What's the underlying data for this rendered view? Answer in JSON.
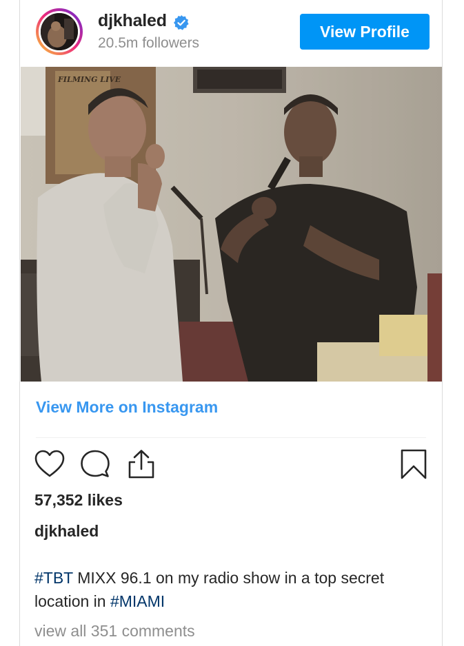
{
  "header": {
    "username": "djkhaled",
    "followers": "20.5m followers",
    "view_profile_label": "View Profile",
    "verified_icon": "verified-badge-icon",
    "accent_color": "#0095f6"
  },
  "post": {
    "image_icon": "photo",
    "image_text": "FILMING LIVE",
    "view_more_label": "View More on Instagram",
    "likes": "57,352 likes",
    "caption_user": "djkhaled",
    "caption": {
      "tag1": "#TBT",
      "text1": " MIXX 96.1 on my radio show in a top secret location in ",
      "tag2": "#MIAMI"
    },
    "comments_link": "view all 351 comments"
  },
  "actions": {
    "like_icon": "heart-icon",
    "comment_icon": "comment-icon",
    "share_icon": "share-icon",
    "save_icon": "bookmark-icon"
  }
}
